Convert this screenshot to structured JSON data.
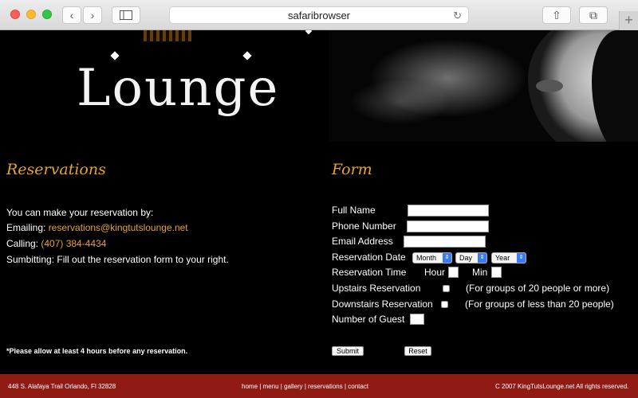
{
  "browser": {
    "address": "safaribrowser",
    "back_glyph": "‹",
    "forward_glyph": "›",
    "reload_glyph": "↻",
    "share_glyph": "⇧",
    "tabs_glyph": "⧉",
    "plus_glyph": "+"
  },
  "site": {
    "logo_text": "Lounge"
  },
  "reservations": {
    "heading": "Reservations",
    "line1": "You can make your reservation by:",
    "email_label": "Emailing: ",
    "email": "reservations@kingtutslounge.net",
    "call_label": "Calling: ",
    "phone": "(407) 384-4434",
    "submit_line": "Sumbitting: Fill out the reservation form to your right.",
    "notice": "*Please allow at least 4 hours before any reservation."
  },
  "form": {
    "heading": "Form",
    "full_name": "Full Name",
    "phone_number": "Phone Number",
    "email_address": "Email Address",
    "reservation_date": "Reservation Date",
    "month": "Month",
    "day": "Day",
    "year": "Year",
    "reservation_time": "Reservation Time",
    "hour": "Hour",
    "min": "Min",
    "upstairs": "Upstairs Reservation",
    "upstairs_note": "(For groups of 20 people or more)",
    "downstairs": "Downstairs Reservation",
    "downstairs_note": "(For groups of less than 20 people)",
    "guests": "Number of Guest",
    "submit": "Submit",
    "reset": "Reset"
  },
  "footer": {
    "address": "448 S. Alafaya Trail Orlando, Fl 32828",
    "links": "home | menu | gallery | reservations | contact",
    "copyright": "C 2007 KingTutsLounge.net All rights reserved."
  },
  "colors": {
    "accent": "#e8a427",
    "footer": "#8f1b14",
    "background": "#000000"
  }
}
